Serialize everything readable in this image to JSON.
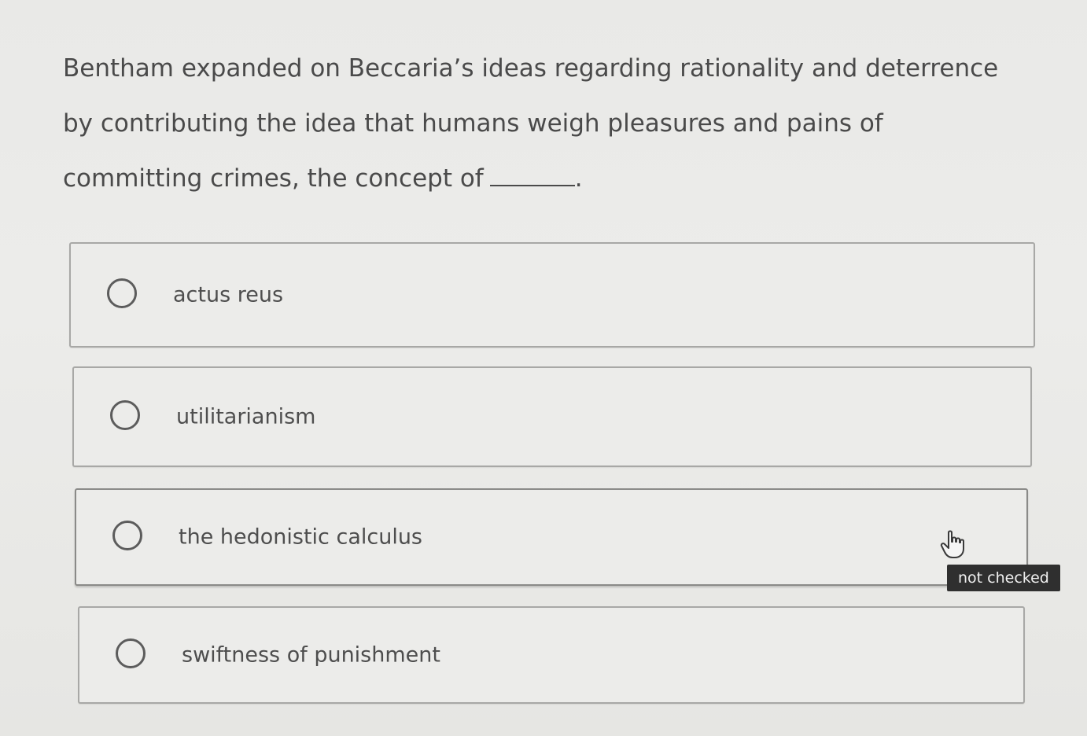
{
  "question": {
    "text": "Bentham expanded on Beccaria’s ideas regarding rationality and deterrence by contributing the idea that humans weigh pleasures and pains of committing crimes, the concept of",
    "trailing_punctuation": "."
  },
  "options": [
    {
      "label": "actus reus",
      "checked": false
    },
    {
      "label": "utilitarianism",
      "checked": false
    },
    {
      "label": "the hedonistic calculus",
      "checked": false
    },
    {
      "label": "swiftness of punishment",
      "checked": false
    }
  ],
  "tooltip": {
    "text": "not checked"
  },
  "cursor": {
    "icon": "hand-pointer-icon"
  }
}
